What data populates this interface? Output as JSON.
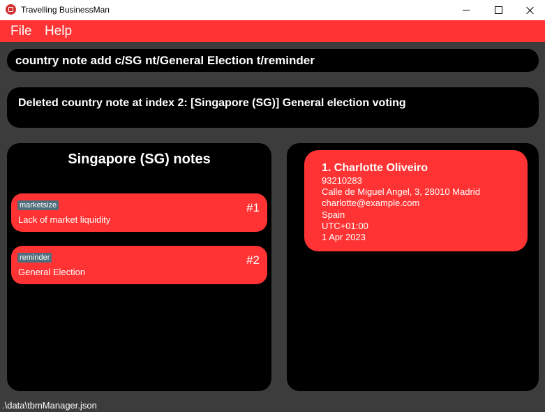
{
  "window": {
    "title": "Travelling BusinessMan"
  },
  "menu": {
    "file": "File",
    "help": "Help"
  },
  "command": {
    "value": "country note add c/SG nt/General Election t/reminder"
  },
  "result": {
    "text": "Deleted country note at index 2: [Singapore (SG)] General election voting"
  },
  "notes": {
    "title": "Singapore (SG) notes",
    "items": [
      {
        "tag": "marketsize",
        "text": "Lack of market liquidity",
        "index": "#1"
      },
      {
        "tag": "reminder",
        "text": "General Election",
        "index": "#2"
      }
    ]
  },
  "contacts": [
    {
      "name": "1.  Charlotte Oliveiro",
      "phone": "93210283",
      "address": "Calle de Miguel Angel, 3, 28010 Madrid",
      "email": "charlotte@example.com",
      "country": "Spain",
      "timezone": "UTC+01:00",
      "date": "1 Apr 2023"
    }
  ],
  "status": {
    "path": ".\\data\\tbmManager.json"
  },
  "colors": {
    "accent": "#ff3333",
    "panel": "#000000",
    "background": "#3c3c3c",
    "tag": "#4f6d7a"
  }
}
